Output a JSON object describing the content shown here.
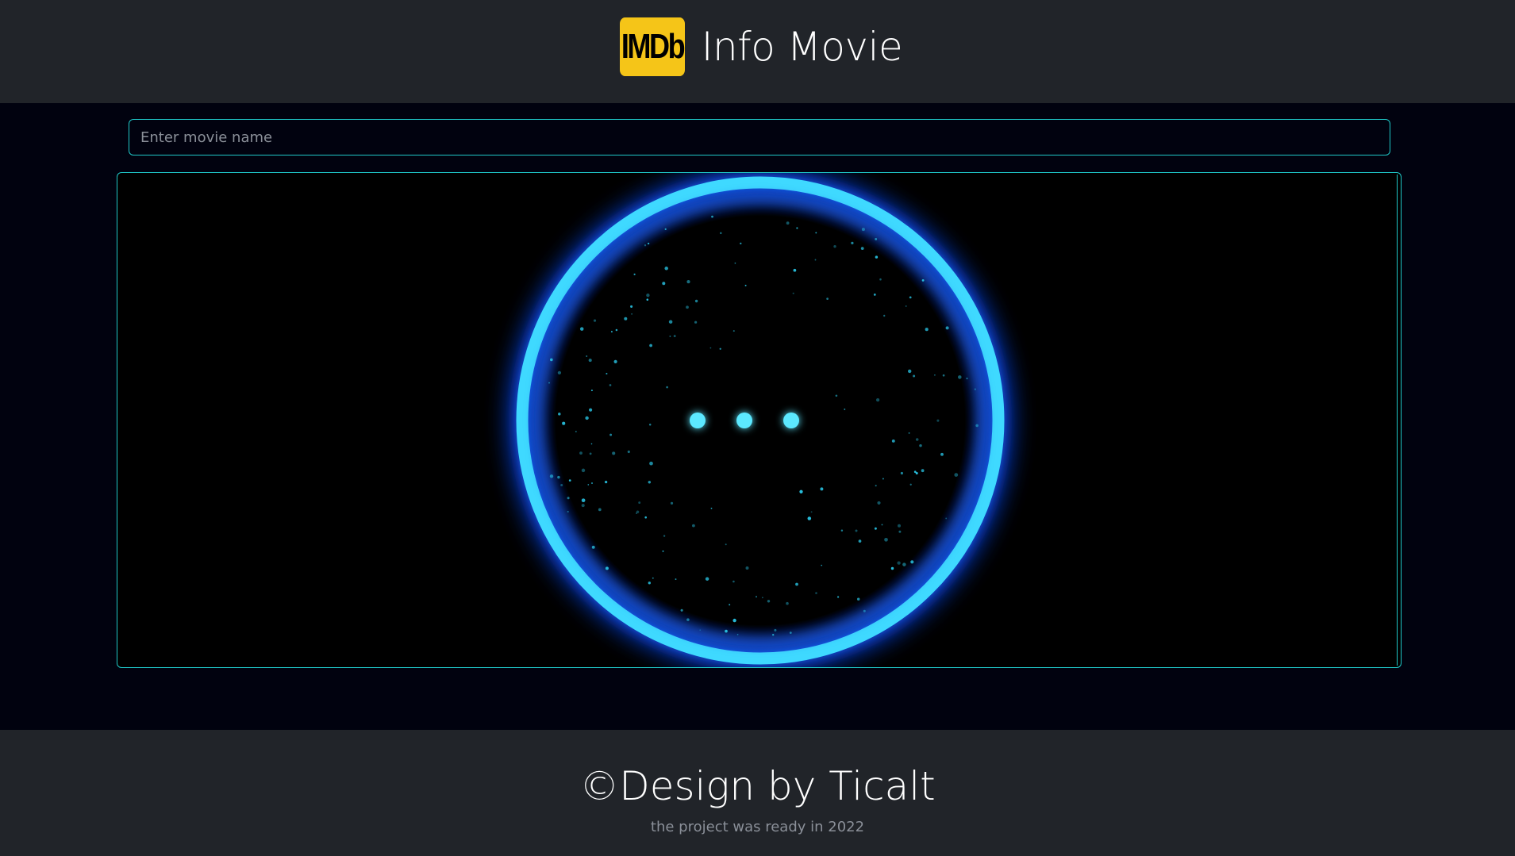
{
  "header": {
    "logo_text": "IMDb",
    "title": "Info Movie"
  },
  "search": {
    "placeholder": "Enter movie name",
    "value": ""
  },
  "loader": {
    "dots": 3,
    "colors": {
      "ring": "#3fd9ff",
      "glow": "#0a4cff",
      "particle": "#29c6e6"
    }
  },
  "footer": {
    "title": "©Design by Ticalt",
    "subtitle": "the project was ready in 2022"
  },
  "colors": {
    "header_bg": "#212429",
    "page_bg": "#01020f",
    "accent": "#1fc8c8",
    "logo_bg": "#f5c518"
  }
}
